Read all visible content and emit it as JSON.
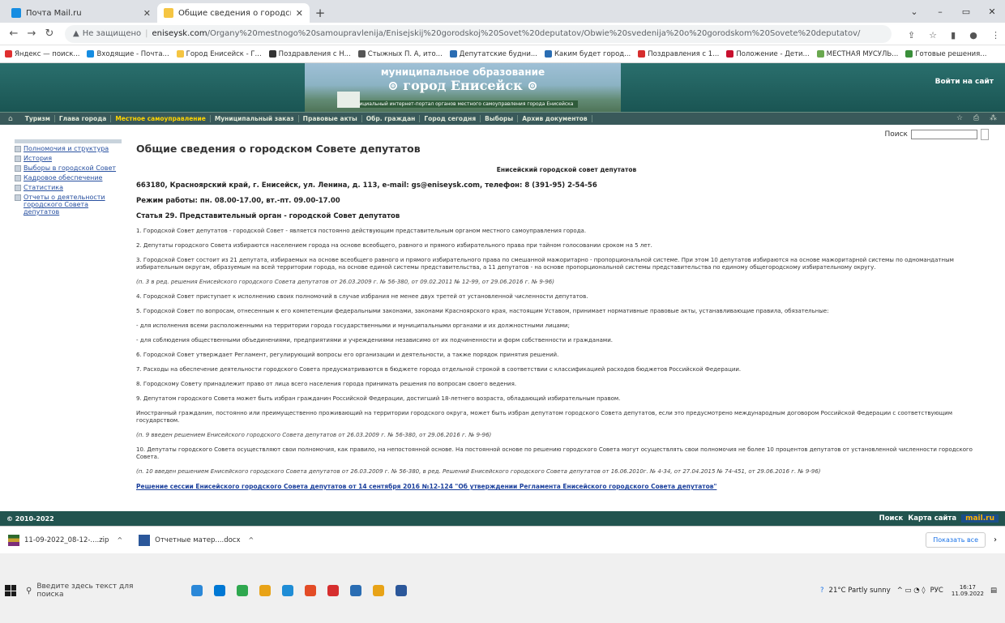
{
  "browser": {
    "tabs": [
      {
        "title": "Почта Mail.ru",
        "favicon_color": "#168de2",
        "active": false
      },
      {
        "title": "Общие сведения о городском С",
        "favicon_color": "#f5c542",
        "active": true
      }
    ],
    "new_tab": "+",
    "window_controls": [
      "⌄",
      "–",
      "▭",
      "✕"
    ],
    "url": {
      "security": "Не защищено",
      "domain": "eniseysk.com",
      "path": "/Organy%20mestnogo%20samoupravlenija/Enisejskij%20gorodskoj%20Sovet%20deputatov/Obwie%20svedenija%20o%20gorodskom%20Sovete%20deputatov/"
    },
    "bookmarks": [
      {
        "label": "Яндекс — поиск...",
        "color": "#e02f2f"
      },
      {
        "label": "Входящие - Почта...",
        "color": "#168de2"
      },
      {
        "label": "Город Енисейск - Г...",
        "color": "#f5c542"
      },
      {
        "label": "Поздравления с Н...",
        "color": "#333333"
      },
      {
        "label": "Стыжных П. А, ито...",
        "color": "#555555"
      },
      {
        "label": "Депутатские будни...",
        "color": "#2a6db3"
      },
      {
        "label": "Каким будет город...",
        "color": "#2a6db3"
      },
      {
        "label": "Поздравления с 1...",
        "color": "#d62e2e"
      },
      {
        "label": "Положение - Дети...",
        "color": "#c8102e"
      },
      {
        "label": "МЕСТНАЯ МУСУЛЬ...",
        "color": "#6aa84f"
      },
      {
        "label": "Готовые решения...",
        "color": "#3a8f3a"
      }
    ]
  },
  "site": {
    "banner": {
      "line1": "муниципальное образование",
      "line2": "⊚ город Енисейск ⊚",
      "line3": "официальный интернет-портал органов местного самоуправления города Енисейска"
    },
    "login": "Войти на сайт",
    "menu": [
      "Туризм",
      "Глава города",
      "Местное самоуправление",
      "Муниципальный заказ",
      "Правовые акты",
      "Обр. граждан",
      "Город сегодня",
      "Выборы",
      "Архив документов"
    ],
    "menu_active_index": 2,
    "search_label": "Поиск",
    "sidebar": [
      "Полномочия и структура",
      "История",
      "Выборы в городской Совет",
      "Кадровое обеспечение",
      "Статистика",
      "Отчеты о деятельности городского Совета депутатов"
    ],
    "page_title": "Общие сведения о городском Совете депутатов",
    "org_name": "Енисейский городской совет депутатов",
    "address": "663180, Красноярский край, г. Енисейск, ул. Ленина, д. 113, e-mail: gs@eniseysk.com, телефон: 8 (391-95) 2-54-56",
    "hours": "Режим работы: пн. 08.00-17.00, вт.-пт. 09.00-17.00",
    "article": "Статья 29. Представительный орган - городской Совет депутатов",
    "paragraphs": [
      {
        "text": "1. Городской Совет депутатов - городской Совет - является постоянно действующим представительным органом местного самоуправления города.",
        "italic": false
      },
      {
        "text": "2. Депутаты городского Совета избираются населением города на основе всеобщего, равного и прямого избирательного права при тайном голосовании сроком на 5 лет.",
        "italic": false
      },
      {
        "text": "3. Городской Совет состоит из 21 депутата, избираемых на основе всеобщего равного и прямого избирательного права по смешанной мажоритарно - пропорциональной системе. При этом 10 депутатов избираются на основе мажоритарной системы по одномандатным избирательным округам, образуемым на всей территории города, на основе единой системы представительства, а 11 депутатов - на основе пропорциональной системы представительства по единому общегородскому избирательному округу.",
        "italic": false
      },
      {
        "text": "(п. 3 в ред. решения Енисейского городского Совета депутатов от 26.03.2009 г. № 56-380, от 09.02.2011 № 12-99, от 29.06.2016 г. № 9-96)",
        "italic": true
      },
      {
        "text": "4. Городской Совет приступает к исполнению своих полномочий в случае избрания не менее двух третей от установленной численности депутатов.",
        "italic": false
      },
      {
        "text": "5. Городской Совет по вопросам, отнесенным к его компетенции федеральными законами, законами Красноярского края, настоящим Уставом, принимает нормативные правовые акты, устанавливающие правила, обязательные:",
        "italic": false
      },
      {
        "text": "- для исполнения всеми расположенными на территории города государственными и муниципальными органами и их должностными лицами;",
        "italic": false
      },
      {
        "text": "- для соблюдения общественными объединениями, предприятиями и учреждениями независимо от их подчиненности и форм собственности и гражданами.",
        "italic": false
      },
      {
        "text": "6. Городской Совет утверждает Регламент, регулирующий вопросы его организации и деятельности, а также порядок принятия решений.",
        "italic": false
      },
      {
        "text": "7. Расходы на обеспечение деятельности городского Совета предусматриваются в бюджете города отдельной строкой в соответствии с классификацией расходов бюджетов Российской Федерации.",
        "italic": false
      },
      {
        "text": "8. Городскому Совету принадлежит право от лица всего населения города принимать решения по вопросам своего ведения.",
        "italic": false
      },
      {
        "text": "9. Депутатом городского Совета может быть избран гражданин Российской Федерации, достигший 18-летнего возраста, обладающий избирательным правом.",
        "italic": false
      },
      {
        "text": "Иностранный гражданин, постоянно или преимущественно проживающий на территории городского округа, может быть избран депутатом городского Совета депутатов, если это предусмотрено международным договором Российской Федерации с соответствующим государством.",
        "italic": false
      },
      {
        "text": "(п. 9 введен решением Енисейского городского Совета депутатов от 26.03.2009 г. № 56-380, от 29.06.2016 г. № 9-96)",
        "italic": true
      },
      {
        "text": "10. Депутаты городского Совета осуществляют свои полномочия, как правило, на непостоянной основе. На постоянной основе по решению городского Совета могут осуществлять свои полномочия не более 10 процентов депутатов от установленной численности городского Совета.",
        "italic": false
      },
      {
        "text": "(п. 10 введен решением Енисейского городского Совета депутатов от 26.03.2009 г. № 56-380, в ред. Решений Енисейского городского Совета депутатов от 16.06.2010г. № 4-34, от 27.04.2015 № 74-451, от 29.06.2016 г. № 9-96)",
        "italic": true
      }
    ],
    "decision_link": "Решение сессии Енисейского городского Совета депутатов от 14 сентября 2016 №12-124 \"Об утверждении Регламента Енисейского городского Совета депутатов\"",
    "footer": {
      "copyright": "© 2010-2022",
      "search": "Поиск",
      "sitemap": "Карта сайта",
      "mailru": "mail.ru"
    }
  },
  "downloads": {
    "items": [
      "11-09-2022_08-12-....zip",
      "Отчетные матер....docx"
    ],
    "show_all": "Показать все"
  },
  "taskbar": {
    "search_placeholder": "Введите здесь текст для поиска",
    "weather": "21°C  Partly sunny",
    "lang": "РУС",
    "time": "16:17",
    "date": "11.09.2022",
    "app_colors": [
      "#2b88d8",
      "#0078d4",
      "#2fa84f",
      "#e8a317",
      "#1f8dd6",
      "#e34c26",
      "#d62e2e",
      "#2a6db3",
      "#e8a317",
      "#2b579a"
    ]
  }
}
